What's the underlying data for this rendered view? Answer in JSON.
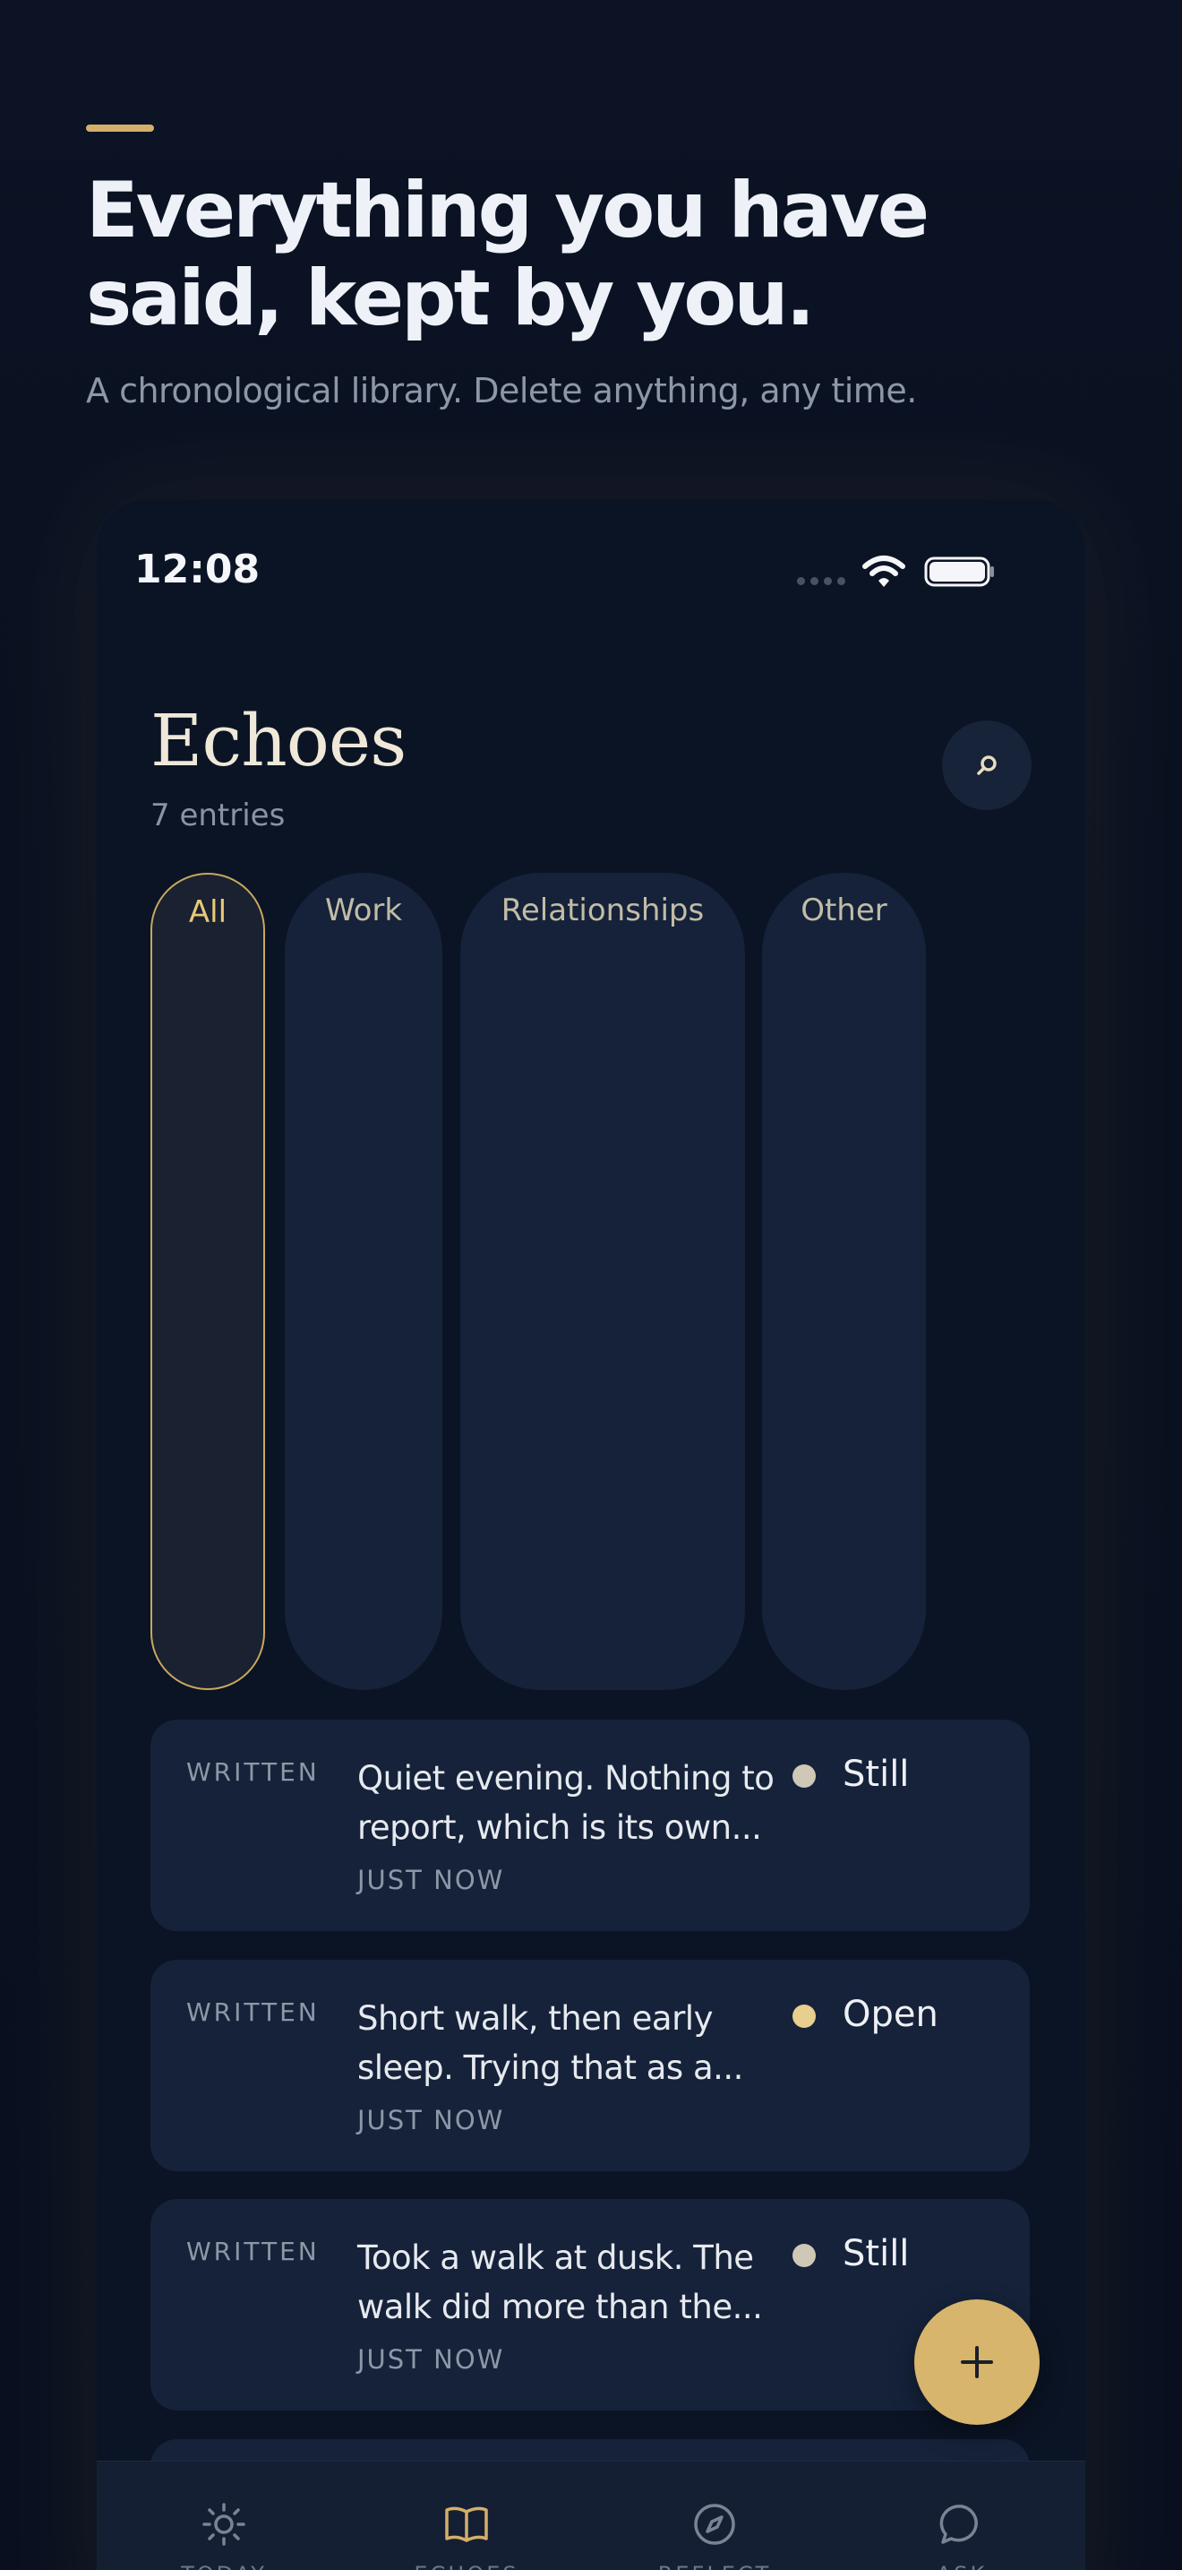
{
  "hero": {
    "title_line1": "Everything you have",
    "title_line2": "said, kept by you.",
    "subtitle": "A chronological library. Delete anything, any time."
  },
  "status_bar": {
    "time": "12:08"
  },
  "app": {
    "title": "Echoes",
    "entry_count": "7 entries"
  },
  "filters": [
    {
      "label": "All",
      "active": true
    },
    {
      "label": "Work",
      "active": false
    },
    {
      "label": "Relationships",
      "active": false
    },
    {
      "label": "Other",
      "active": false
    }
  ],
  "entries": [
    {
      "type": "WRITTEN",
      "text": "Quiet evening. Nothing to report, which is its own...",
      "time": "JUST NOW",
      "mood": "Still",
      "mood_color": "#cfc8b6"
    },
    {
      "type": "WRITTEN",
      "text": "Short walk, then early sleep. Trying that as a...",
      "time": "JUST NOW",
      "mood": "Open",
      "mood_color": "#e8cf8e"
    },
    {
      "type": "WRITTEN",
      "text": "Took a walk at dusk. The walk did more than the...",
      "time": "JUST NOW",
      "mood": "Still",
      "mood_color": "#cfc8b6"
    }
  ],
  "fab": {
    "icon": "plus-icon"
  },
  "tabs": [
    {
      "icon": "sun-icon",
      "label": "TODAY"
    },
    {
      "icon": "book-icon",
      "label": "ECHOES",
      "active": true
    },
    {
      "icon": "compass-icon",
      "label": "REFLECT"
    },
    {
      "icon": "chat-icon",
      "label": "ASK"
    }
  ],
  "colors": {
    "accent": "#d4af6a",
    "background": "#0a1120",
    "card": "#15223a"
  }
}
